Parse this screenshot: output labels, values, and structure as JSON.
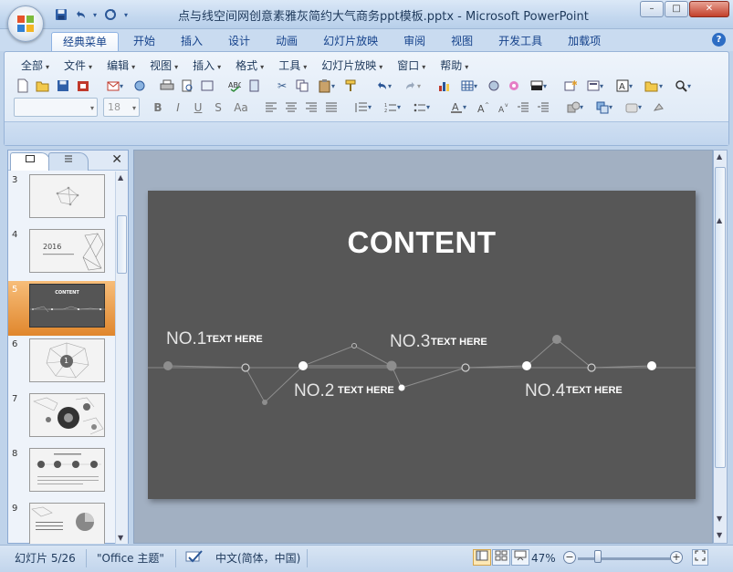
{
  "window": {
    "title": "点与线空间网创意素雅灰简约大气商务ppt模板.pptx - Microsoft PowerPoint",
    "controls": [
      "–",
      "□",
      "✕"
    ]
  },
  "ribbon_tabs": [
    "经典菜单",
    "开始",
    "插入",
    "设计",
    "动画",
    "幻灯片放映",
    "审阅",
    "视图",
    "开发工具",
    "加载项"
  ],
  "active_tab": "经典菜单",
  "classic_menu": [
    "全部",
    "文件",
    "编辑",
    "视图",
    "插入",
    "格式",
    "工具",
    "幻灯片放映",
    "窗口",
    "帮助"
  ],
  "font_combo": {
    "font": "",
    "size": "18"
  },
  "format_buttons": {
    "bold": "B",
    "italic": "I",
    "underline": "U",
    "shadow": "S",
    "case": "Aa"
  },
  "thumbnails": [
    {
      "num": "3",
      "text": ""
    },
    {
      "num": "4",
      "text": "2016"
    },
    {
      "num": "5",
      "text": "CONTENT"
    },
    {
      "num": "6",
      "text": "1"
    },
    {
      "num": "7",
      "text": ""
    },
    {
      "num": "8",
      "text": ""
    },
    {
      "num": "9",
      "text": ""
    }
  ],
  "selected_slide": "5",
  "slide": {
    "title": "CONTENT",
    "items": [
      {
        "no": "NO.1",
        "text": "TEXT HERE"
      },
      {
        "no": "NO.2",
        "text": "TEXT HERE"
      },
      {
        "no": "NO.3",
        "text": "TEXT HERE"
      },
      {
        "no": "NO.4",
        "text": "TEXT HERE"
      }
    ]
  },
  "status": {
    "slide_info": "幻灯片 5/26",
    "theme": "\"Office 主题\"",
    "language": "中文(简体，中国)",
    "zoom": "47%"
  },
  "colors": {
    "slide_bg": "#575757",
    "selected_thumb": "#e0872d",
    "title_text": "#ffffff"
  }
}
